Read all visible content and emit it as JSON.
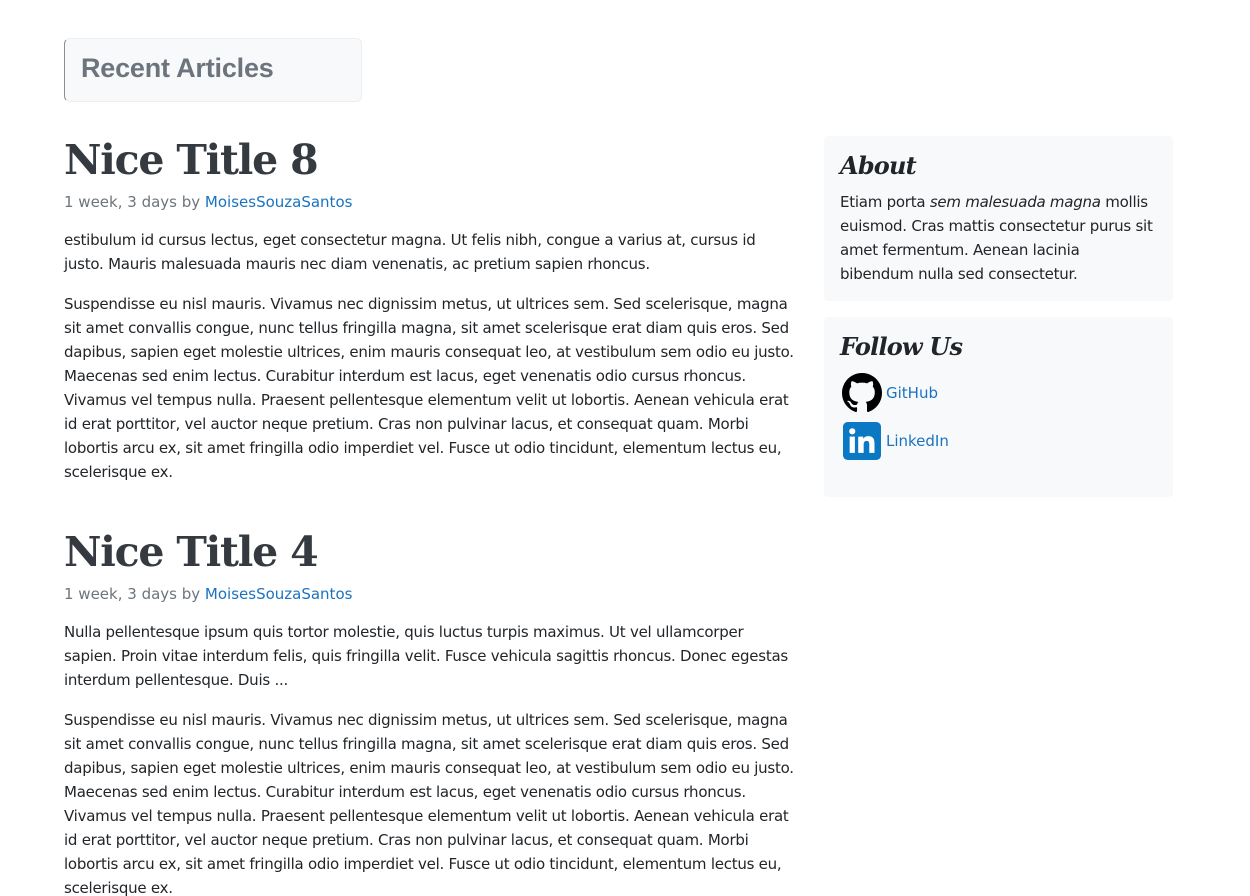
{
  "header": {
    "title": "Recent Articles"
  },
  "articles": [
    {
      "title": "Nice Title 8",
      "meta_prefix": "1 week, 3 days by ",
      "author": "MoisesSouzaSantos",
      "paragraphs": [
        "estibulum id cursus lectus, eget consectetur magna. Ut felis nibh, congue a varius at, cursus id justo. Mauris malesuada mauris nec diam venenatis, ac pretium sapien rhoncus.",
        "Suspendisse eu nisl mauris. Vivamus nec dignissim metus, ut ultrices sem. Sed scelerisque, magna sit amet convallis congue, nunc tellus fringilla magna, sit amet scelerisque erat diam quis eros. Sed dapibus, sapien eget molestie ultrices, enim mauris consequat leo, at vestibulum sem odio eu justo. Maecenas sed enim lectus. Curabitur interdum est lacus, eget venenatis odio cursus rhoncus. Vivamus vel tempus nulla. Praesent pellentesque elementum velit ut lobortis. Aenean vehicula erat id erat porttitor, vel auctor neque pretium. Cras non pulvinar lacus, et consequat quam. Morbi lobortis arcu ex, sit amet fringilla odio imperdiet vel. Fusce ut odio tincidunt, elementum lectus eu, scelerisque ex."
      ]
    },
    {
      "title": "Nice Title 4",
      "meta_prefix": "1 week, 3 days by ",
      "author": "MoisesSouzaSantos",
      "paragraphs": [
        "Nulla pellentesque ipsum quis tortor molestie, quis luctus turpis maximus. Ut vel ullamcorper sapien. Proin vitae interdum felis, quis fringilla velit. Fusce vehicula sagittis rhoncus. Donec egestas interdum pellentesque. Duis ...",
        "Suspendisse eu nisl mauris. Vivamus nec dignissim metus, ut ultrices sem. Sed scelerisque, magna sit amet convallis congue, nunc tellus fringilla magna, sit amet scelerisque erat diam quis eros. Sed dapibus, sapien eget molestie ultrices, enim mauris consequat leo, at vestibulum sem odio eu justo. Maecenas sed enim lectus. Curabitur interdum est lacus, eget venenatis odio cursus rhoncus. Vivamus vel tempus nulla. Praesent pellentesque elementum velit ut lobortis. Aenean vehicula erat id erat porttitor, vel auctor neque pretium. Cras non pulvinar lacus, et consequat quam. Morbi lobortis arcu ex, sit amet fringilla odio imperdiet vel. Fusce ut odio tincidunt, elementum lectus eu, scelerisque ex."
      ]
    }
  ],
  "sidebar": {
    "about": {
      "title": "About",
      "text_before": "Etiam porta ",
      "text_emphasis": "sem malesuada magna",
      "text_after": " mollis euismod. Cras mattis consectetur purus sit amet fermentum. Aenean lacinia bibendum nulla sed consectetur."
    },
    "follow": {
      "title": "Follow Us",
      "links": [
        {
          "label": "GitHub",
          "icon": "github-icon"
        },
        {
          "label": "LinkedIn",
          "icon": "linkedin-icon"
        }
      ]
    }
  },
  "colors": {
    "link": "#1a73c0",
    "muted": "#6c757d",
    "panel": "#f8f9fa",
    "linkedin": "#0a66c2"
  }
}
